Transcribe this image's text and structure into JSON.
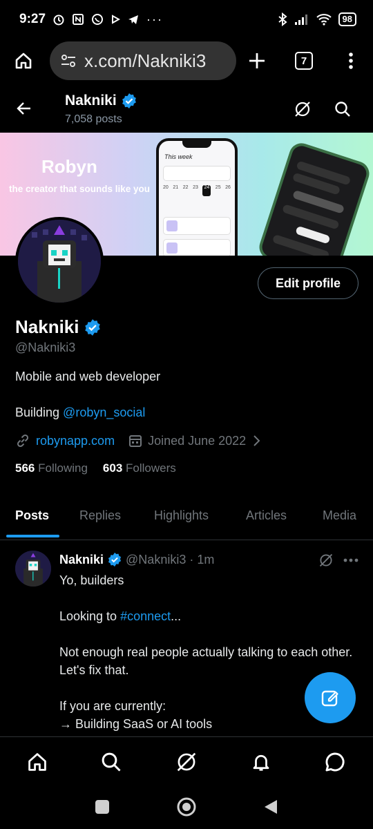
{
  "status_bar": {
    "time": "9:27",
    "battery": "98"
  },
  "browser": {
    "url": "x.com/Nakniki3",
    "tab_count": "7"
  },
  "header": {
    "name": "Nakniki",
    "posts_count": "7,058 posts"
  },
  "banner": {
    "title": "Robyn",
    "subtitle": "the creator  that sounds like you",
    "phone_heading": "This week"
  },
  "profile": {
    "edit_button": "Edit profile",
    "name": "Nakniki",
    "handle": "@Nakniki3",
    "bio_line1": "Mobile and web developer",
    "bio_line2_prefix": "Building ",
    "bio_line2_mention": "@robyn_social",
    "website": "robynapp.com",
    "joined": "Joined June 2022",
    "following_count": "566",
    "following_label": "Following",
    "followers_count": "603",
    "followers_label": "Followers"
  },
  "tabs": [
    {
      "label": "Posts"
    },
    {
      "label": "Replies"
    },
    {
      "label": "Highlights"
    },
    {
      "label": "Articles"
    },
    {
      "label": "Media"
    }
  ],
  "post": {
    "author": "Nakniki",
    "handle_time": "@Nakniki3 · 1m",
    "line1": "Yo, builders",
    "line2_prefix": "Looking to ",
    "line2_hashtag": "#connect",
    "line2_suffix": "...",
    "line3": "Not enough real people actually talking to each other. Let's fix that.",
    "line4": "If you are currently:",
    "line5": "→ Building SaaS or AI tools"
  },
  "colors": {
    "accent": "#1d9bf0",
    "background": "#000000",
    "muted": "#71767b"
  }
}
